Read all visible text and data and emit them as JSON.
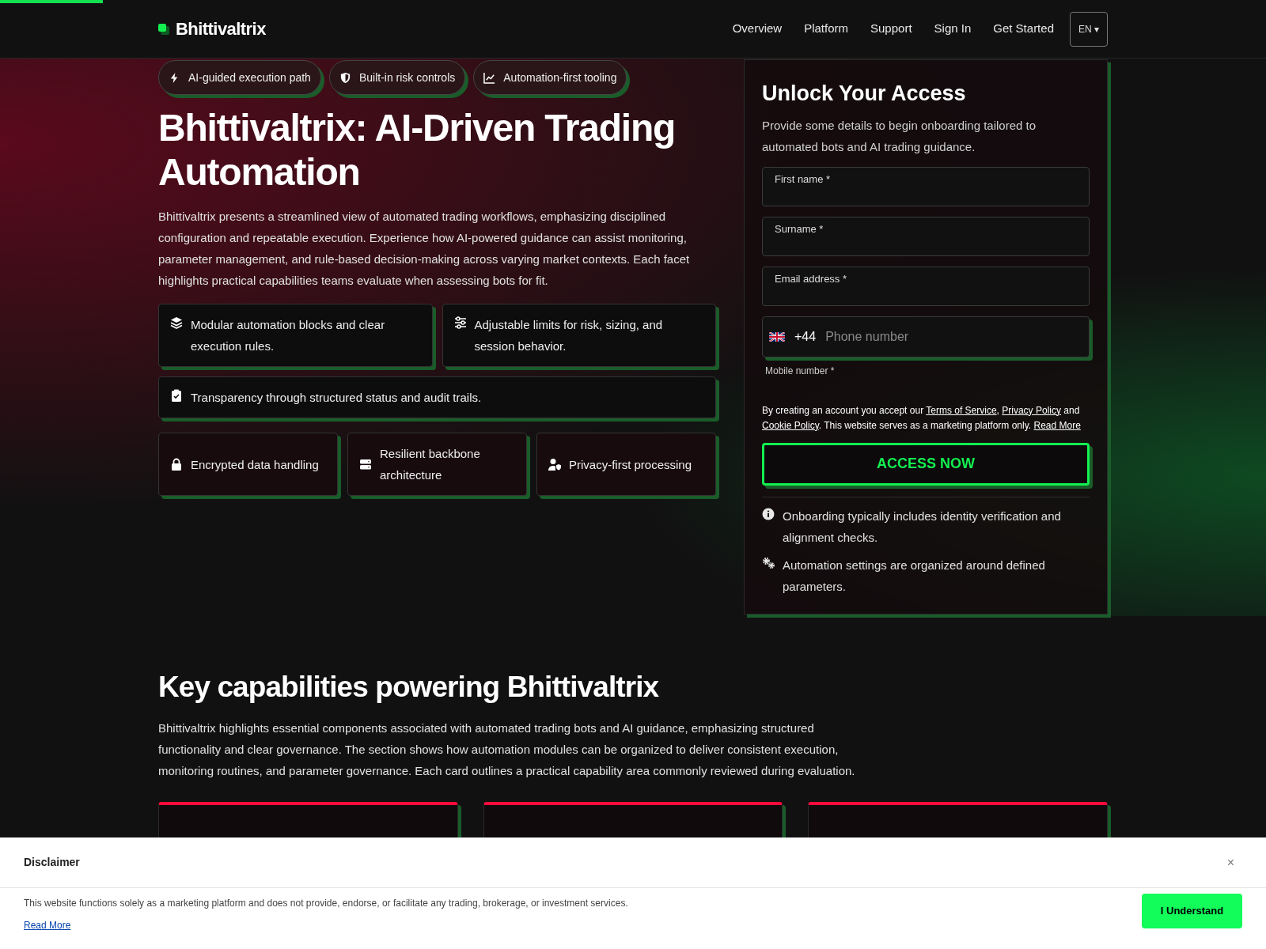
{
  "header": {
    "brand": "Bhittivaltrix",
    "nav": [
      "Overview",
      "Platform",
      "Support",
      "Sign In",
      "Get Started"
    ],
    "language": "EN ▾"
  },
  "hero": {
    "chips": [
      {
        "label": "AI-guided execution path"
      },
      {
        "label": "Built-in risk controls"
      },
      {
        "label": "Automation-first tooling"
      }
    ],
    "title": "Bhittivaltrix: AI-Driven Trading Automation",
    "intro": "Bhittivaltrix presents a streamlined view of automated trading workflows, emphasizing disciplined configuration and repeatable execution. Experience how AI-powered guidance can assist monitoring, parameter management, and rule-based decision-making across varying market contexts. Each facet highlights practical capabilities teams evaluate when assessing bots for fit.",
    "features": [
      {
        "text": "Modular automation blocks and clear execution rules."
      },
      {
        "text": "Adjustable limits for risk, sizing, and session behavior."
      },
      {
        "text": "Transparency through structured status and audit trails."
      }
    ],
    "trust": [
      {
        "text": "Encrypted data handling"
      },
      {
        "text": "Resilient backbone architecture"
      },
      {
        "text": "Privacy-first processing"
      }
    ]
  },
  "form": {
    "title": "Unlock Your Access",
    "subtitle": "Provide some details to begin onboarding tailored to automated bots and AI trading guidance.",
    "fields": [
      "First name *",
      "Surname *",
      "Email address *"
    ],
    "phone": {
      "code": "+44",
      "placeholder": "Phone number",
      "label": "Mobile number *"
    },
    "consent": [
      {
        "kind": "text",
        "text": "By creating an account you accept our "
      },
      {
        "kind": "link",
        "text": "Terms of Service"
      },
      {
        "kind": "text",
        "text": ", "
      },
      {
        "kind": "link",
        "text": "Privacy Policy"
      },
      {
        "kind": "text",
        "text": " and "
      },
      {
        "kind": "link",
        "text": "Cookie Policy"
      },
      {
        "kind": "text",
        "text": ". This website serves as a marketing platform only. "
      },
      {
        "kind": "link",
        "text": "Read More"
      }
    ],
    "button": "ACCESS NOW",
    "notes": [
      {
        "text": "Onboarding typically includes identity verification and alignment checks."
      },
      {
        "text": "Automation settings are organized around defined parameters."
      }
    ]
  },
  "capabilities": {
    "title": "Key capabilities powering Bhittivaltrix",
    "intro": "Bhittivaltrix highlights essential components associated with automated trading bots and AI guidance, emphasizing structured functionality and clear governance. The section shows how automation modules can be organized to deliver consistent execution, monitoring routines, and parameter governance. Each card outlines a practical capability area commonly reviewed during evaluation.",
    "cards": [
      {
        "kind": "capability"
      },
      {
        "kind": "capability"
      },
      {
        "kind": "capability"
      }
    ]
  },
  "disclaimer": {
    "title": "Disclaimer",
    "close": "×",
    "text": "This website functions solely as a marketing platform and does not provide, endorse, or facilitate any trading, brokerage, or investment services.",
    "link": "Read More",
    "button": "I Understand"
  }
}
